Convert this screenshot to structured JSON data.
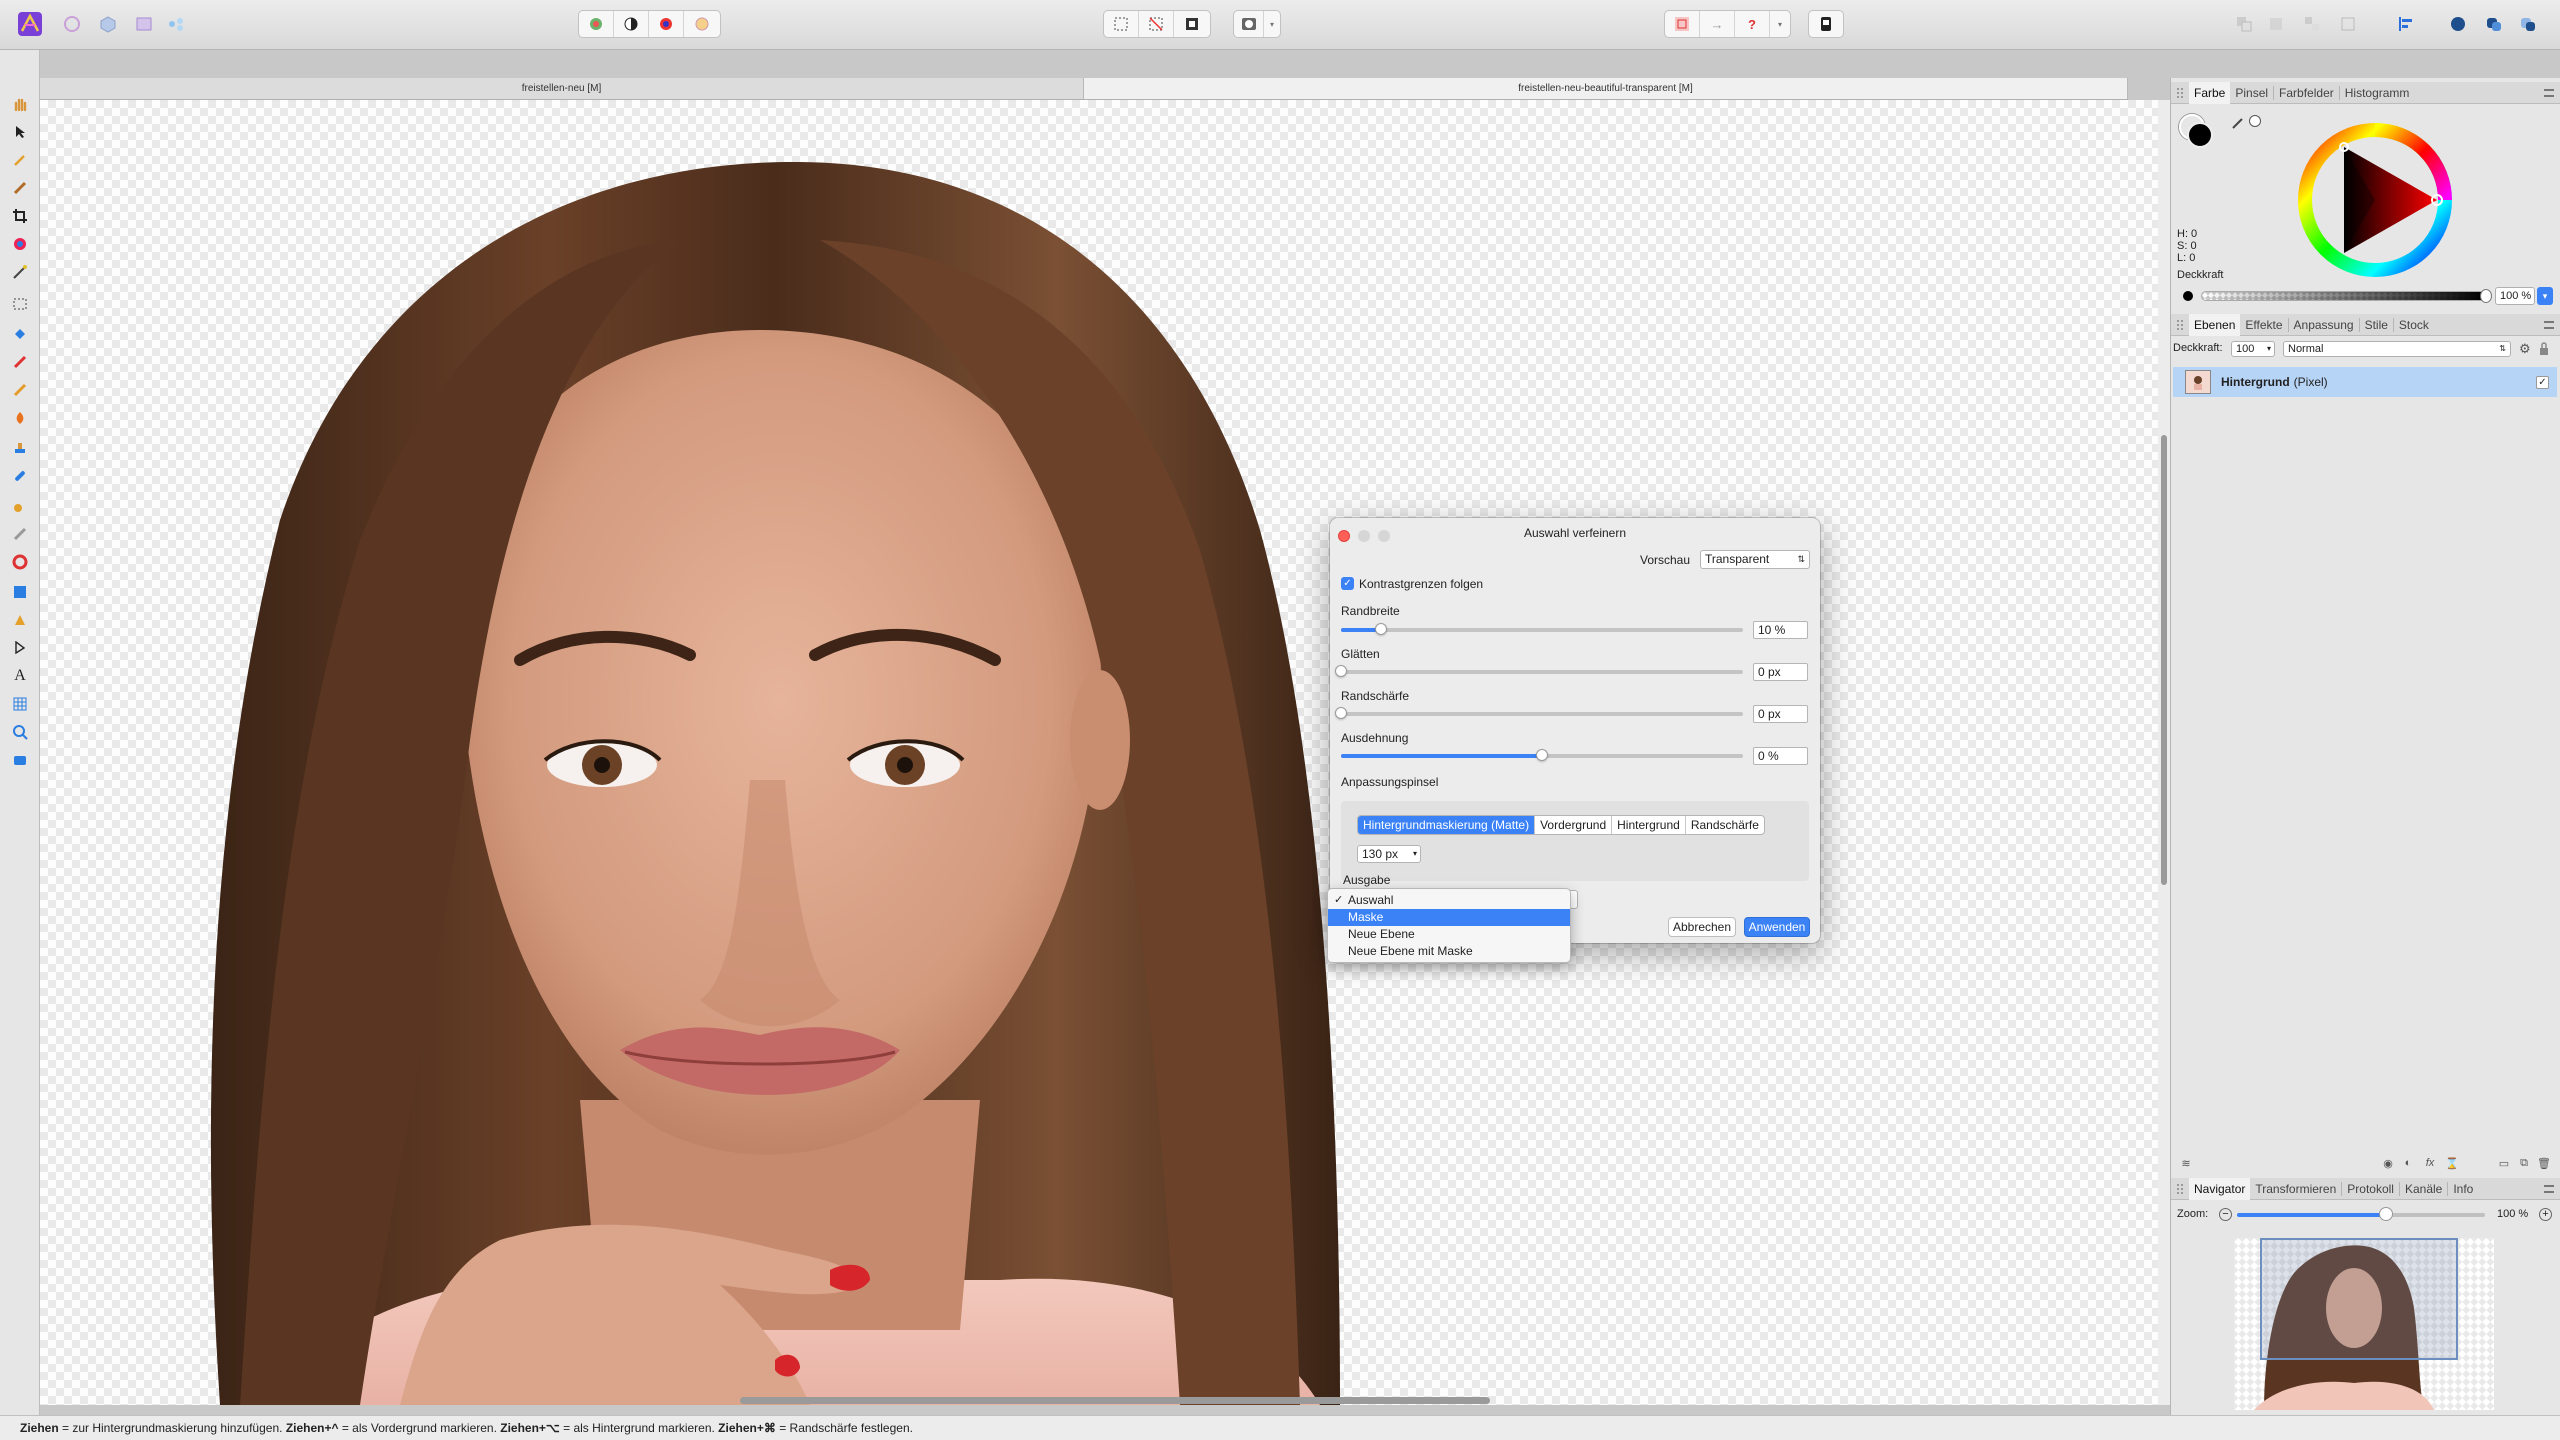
{
  "toolbar": {
    "personas": [
      "photo-persona",
      "liquify-persona",
      "develop-persona",
      "tone-mapping-persona",
      "export-persona"
    ],
    "zoom_select": "selection-tools"
  },
  "documents": {
    "tabs": [
      "freistellen-neu [M]",
      "freistellen-neu-beautiful-transparent [M]"
    ]
  },
  "color_panel": {
    "tabs": [
      "Farbe",
      "Pinsel",
      "Farbfelder",
      "Histogramm"
    ],
    "h": "H: 0",
    "s": "S: 0",
    "l": "L: 0",
    "opacity_label": "Deckkraft",
    "opacity_value": "100 %",
    "opacity_level": 1.0
  },
  "layers_panel": {
    "tabs": [
      "Ebenen",
      "Effekte",
      "Anpassung",
      "Stile",
      "Stock"
    ],
    "opacity_label": "Deckkraft:",
    "opacity_value": "100",
    "blend_mode": "Normal",
    "layers": [
      {
        "name": "Hintergrund",
        "type": "(Pixel)"
      }
    ]
  },
  "navigator_panel": {
    "tabs": [
      "Navigator",
      "Transformieren",
      "Protokoll",
      "Kanäle",
      "Info"
    ],
    "zoom_label": "Zoom:",
    "zoom_value": "100 %",
    "zoom_level": 0.6
  },
  "dialog": {
    "title": "Auswahl verfeinern",
    "preview_label": "Vorschau",
    "preview_value": "Transparent",
    "contrast_label": "Kontrastgrenzen folgen",
    "contrast_checked": true,
    "sliders": [
      {
        "label": "Randbreite",
        "value": "10 %",
        "level": 0.1
      },
      {
        "label": "Glätten",
        "value": "0 px",
        "level": 0.0
      },
      {
        "label": "Randschärfe",
        "value": "0 px",
        "level": 0.0
      },
      {
        "label": "Ausdehnung",
        "value": "0 %",
        "level": 0.5
      }
    ],
    "brush_label": "Anpassungspinsel",
    "brush_modes": [
      "Hintergrundmaskierung (Matte)",
      "Vordergrund",
      "Hintergrund",
      "Randschärfe"
    ],
    "brush_active": 0,
    "brush_size": "130 px",
    "output_label": "Ausgabe",
    "cancel_label": "Abbrechen",
    "apply_label": "Anwenden"
  },
  "output_menu": {
    "items": [
      "Auswahl",
      "Maske",
      "Neue Ebene",
      "Neue Ebene mit Maske"
    ],
    "checked": 0,
    "highlighted": 1
  },
  "statusbar": {
    "k1": "Ziehen",
    "t1": " = zur Hintergrundmaskierung hinzufügen. ",
    "k2": "Ziehen+^",
    "t2": " = als Vordergrund markieren. ",
    "k3": "Ziehen+⌥",
    "t3": " = als Hintergrund markieren. ",
    "k4": "Ziehen+⌘",
    "t4": " = Randschärfe festlegen."
  },
  "colors": {
    "accent": "#3b82f6",
    "layer_selected": "#b6d4f5",
    "close": "#fe5f57"
  }
}
